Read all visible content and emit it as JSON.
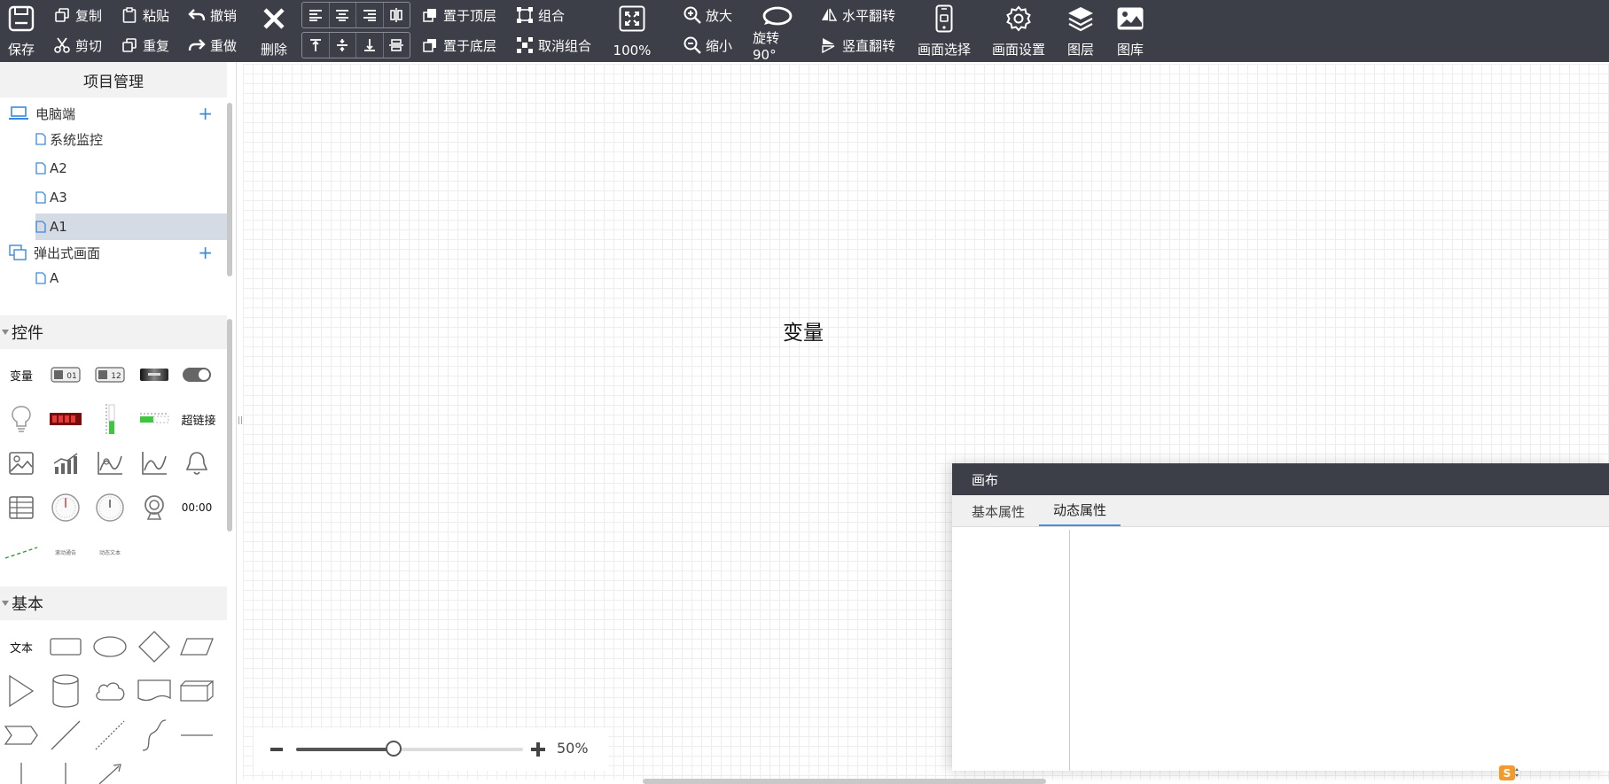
{
  "toolbar": {
    "save": "保存",
    "copy": "复制",
    "paste": "粘贴",
    "undo": "撤销",
    "cut": "剪切",
    "redo_repeat": "重复",
    "redo": "重做",
    "delete": "删除",
    "bring_to_top": "置于顶层",
    "send_to_bottom": "置于底层",
    "group": "组合",
    "ungroup": "取消组合",
    "zoom_level": "100%",
    "zoom_in": "放大",
    "zoom_out": "缩小",
    "rotate": "旋转90°",
    "flip_h": "水平翻转",
    "flip_v": "竖直翻转",
    "screen_select": "画面选择",
    "screen_settings": "画面设置",
    "layers": "图层",
    "gallery": "图库"
  },
  "sidebar": {
    "project_title": "项目管理",
    "tree": [
      {
        "label": "电脑端",
        "type": "group",
        "icon": "laptop-icon"
      },
      {
        "label": "系统监控",
        "type": "page"
      },
      {
        "label": "A2",
        "type": "page"
      },
      {
        "label": "A3",
        "type": "page"
      },
      {
        "label": "A1",
        "type": "page",
        "selected": true
      },
      {
        "label": "弹出式画面",
        "type": "group",
        "icon": "popup-icon"
      },
      {
        "label": "A",
        "type": "page"
      }
    ],
    "controls_title": "控件",
    "controls": {
      "variable": "变量",
      "hyperlink": "超链接",
      "toggle_01": "01",
      "toggle_12": "12",
      "clock_text": "00:00",
      "tiny_label_1": "滚动通告",
      "tiny_label_2": "动态文本"
    },
    "basic_title": "基本",
    "basic": {
      "text": "文本"
    }
  },
  "canvas": {
    "variable_text": "变量",
    "zoom_percent": "50%",
    "zoom_value": 0.5
  },
  "panel": {
    "title": "画布",
    "tabs": [
      "基本属性",
      "动态属性"
    ],
    "active_tab": 1
  },
  "colors": {
    "toolbar_bg": "#3c3f47",
    "accent": "#3b8ad9",
    "selected_row": "#d5dbe5"
  }
}
